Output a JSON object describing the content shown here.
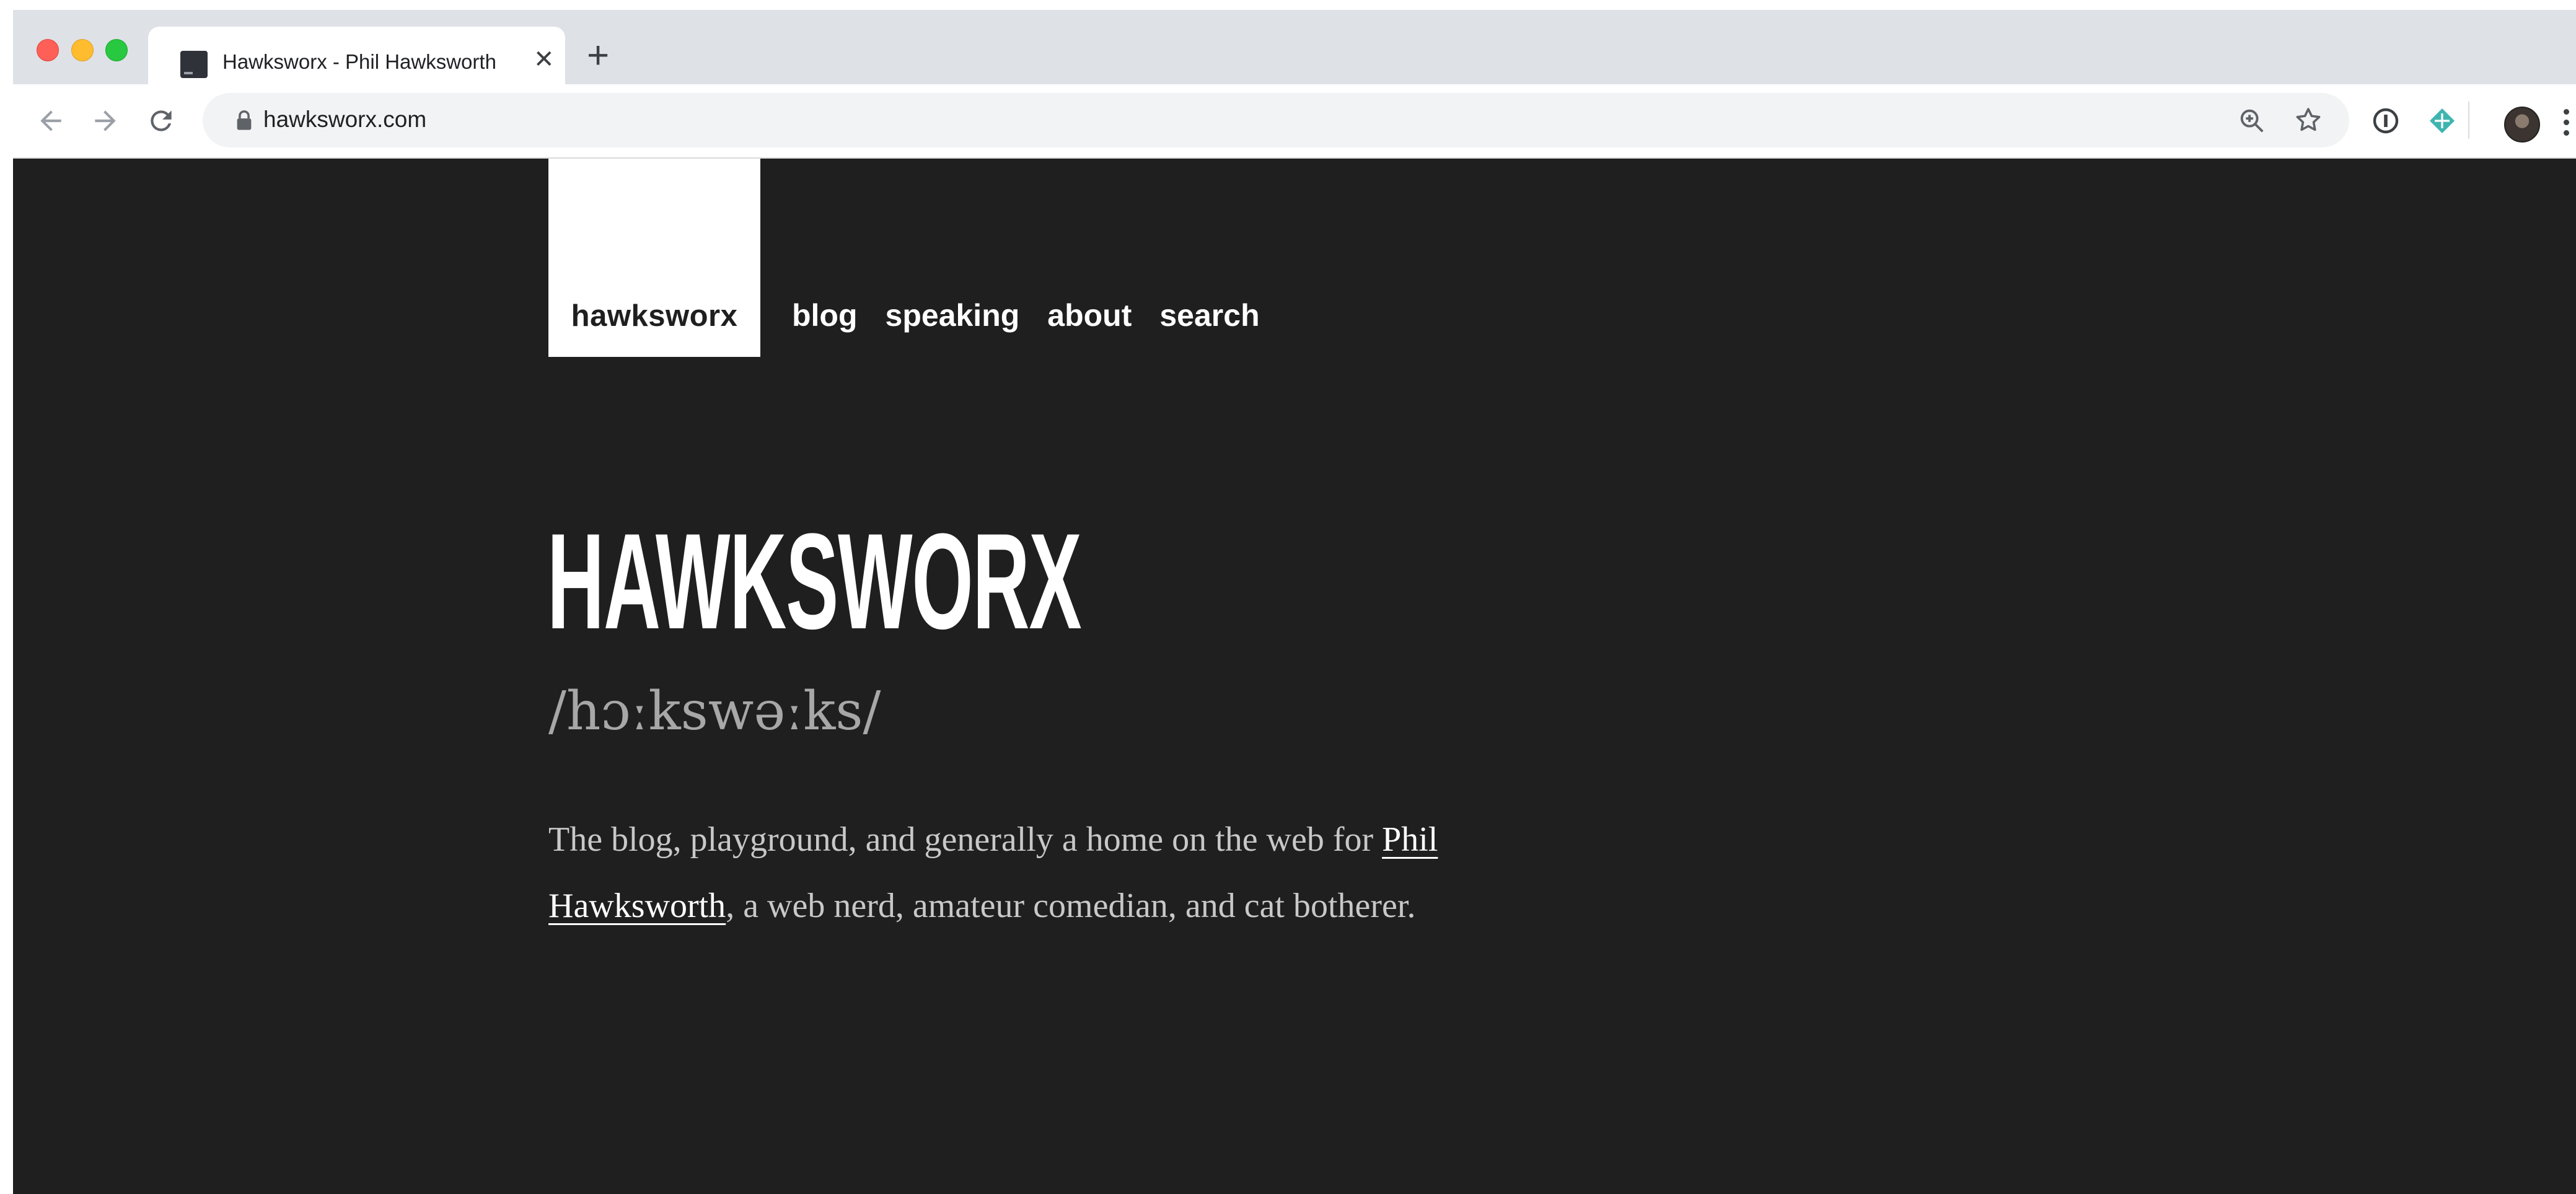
{
  "browser": {
    "tab": {
      "title": "Hawksworx - Phil Hawksworth",
      "close_symbol": "✕"
    },
    "new_tab_symbol": "+",
    "address_bar": {
      "url": "hawksworx.com"
    }
  },
  "site": {
    "logo": "hawksworx",
    "nav": [
      "blog",
      "speaking",
      "about",
      "search"
    ],
    "hero": {
      "title": "HAWKSWORX",
      "pronunciation": "/hɔːkswəːks/"
    },
    "intro": {
      "before": "The blog, playground, and generally a home on the web for ",
      "link": "Phil Hawksworth",
      "after": ", a web nerd, amateur comedian, and cat botherer."
    }
  },
  "colors": {
    "page_bg": "#1f1f1f",
    "logo_bg": "#ffffff",
    "text_light": "#ffffff",
    "text_muted": "#a7a7a7"
  }
}
